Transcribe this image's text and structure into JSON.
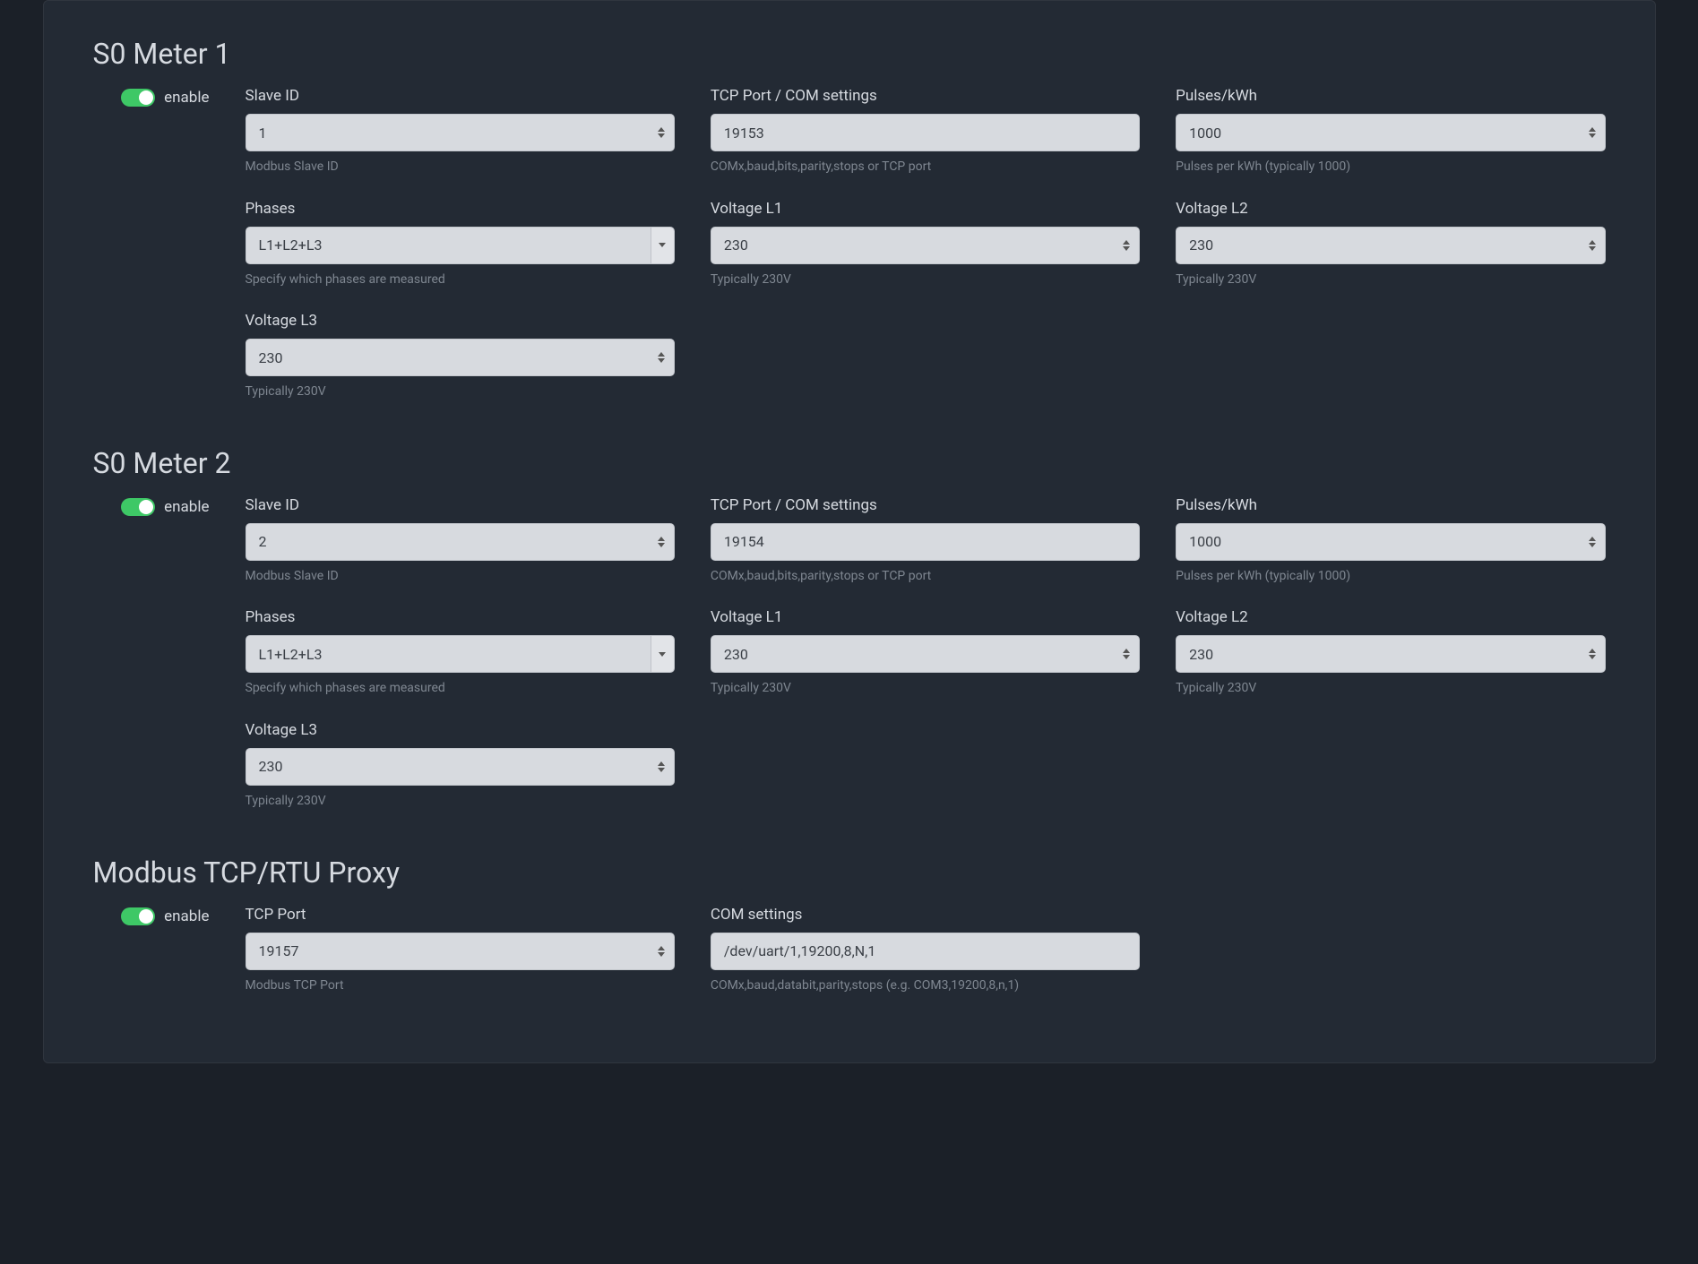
{
  "common": {
    "enable_label": "enable"
  },
  "meter1": {
    "title": "S0 Meter 1",
    "slave_id": {
      "label": "Slave ID",
      "value": "1",
      "helper": "Modbus Slave ID"
    },
    "tcp": {
      "label": "TCP Port / COM settings",
      "value": "19153",
      "helper": "COMx,baud,bits,parity,stops or TCP port"
    },
    "pulses": {
      "label": "Pulses/kWh",
      "value": "1000",
      "helper": "Pulses per kWh (typically 1000)"
    },
    "phases": {
      "label": "Phases",
      "value": "L1+L2+L3",
      "helper": "Specify which phases are measured"
    },
    "v_l1": {
      "label": "Voltage L1",
      "value": "230",
      "helper": "Typically 230V"
    },
    "v_l2": {
      "label": "Voltage L2",
      "value": "230",
      "helper": "Typically 230V"
    },
    "v_l3": {
      "label": "Voltage L3",
      "value": "230",
      "helper": "Typically 230V"
    }
  },
  "meter2": {
    "title": "S0 Meter 2",
    "slave_id": {
      "label": "Slave ID",
      "value": "2",
      "helper": "Modbus Slave ID"
    },
    "tcp": {
      "label": "TCP Port / COM settings",
      "value": "19154",
      "helper": "COMx,baud,bits,parity,stops or TCP port"
    },
    "pulses": {
      "label": "Pulses/kWh",
      "value": "1000",
      "helper": "Pulses per kWh (typically 1000)"
    },
    "phases": {
      "label": "Phases",
      "value": "L1+L2+L3",
      "helper": "Specify which phases are measured"
    },
    "v_l1": {
      "label": "Voltage L1",
      "value": "230",
      "helper": "Typically 230V"
    },
    "v_l2": {
      "label": "Voltage L2",
      "value": "230",
      "helper": "Typically 230V"
    },
    "v_l3": {
      "label": "Voltage L3",
      "value": "230",
      "helper": "Typically 230V"
    }
  },
  "proxy": {
    "title": "Modbus TCP/RTU Proxy",
    "tcp_port": {
      "label": "TCP Port",
      "value": "19157",
      "helper": "Modbus TCP Port"
    },
    "com": {
      "label": "COM settings",
      "value": "/dev/uart/1,19200,8,N,1",
      "helper": "COMx,baud,databit,parity,stops (e.g. COM3,19200,8,n,1)"
    }
  }
}
